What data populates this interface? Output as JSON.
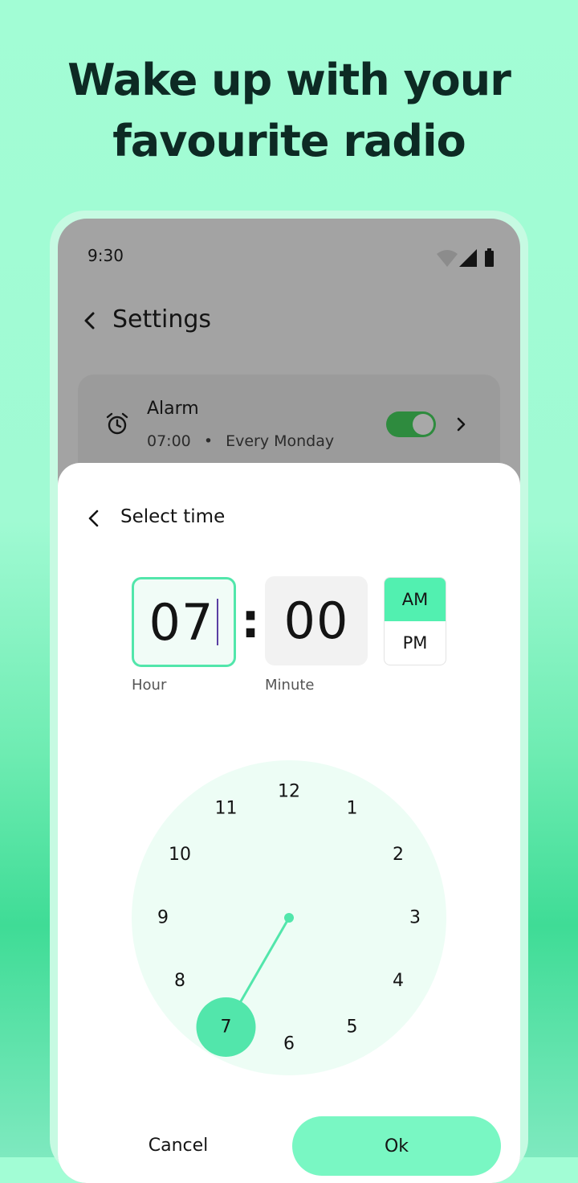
{
  "headline": {
    "line1": "Wake up with your",
    "line2": "favourite radio"
  },
  "status_bar": {
    "time": "9:30",
    "icons": [
      "wifi-icon",
      "signal-icon",
      "battery-icon"
    ]
  },
  "settings": {
    "title": "Settings",
    "alarm": {
      "title": "Alarm",
      "time": "07:00",
      "separator": "•",
      "repeat": "Every Monday",
      "enabled": true
    }
  },
  "time_picker": {
    "title": "Select time",
    "hour": "07",
    "minute": "00",
    "hour_label": "Hour",
    "minute_label": "Minute",
    "am_label": "AM",
    "pm_label": "PM",
    "selected_period": "AM",
    "clock_numbers": [
      "12",
      "1",
      "2",
      "3",
      "4",
      "5",
      "6",
      "7",
      "8",
      "9",
      "10",
      "11"
    ],
    "selected_hour": "7",
    "cancel_label": "Cancel",
    "ok_label": "Ok"
  },
  "colors": {
    "accent": "#52f0b0",
    "hand": "#52e6ab",
    "clock_face": "#edfdf5",
    "toggle_on": "#2e8b3e"
  }
}
